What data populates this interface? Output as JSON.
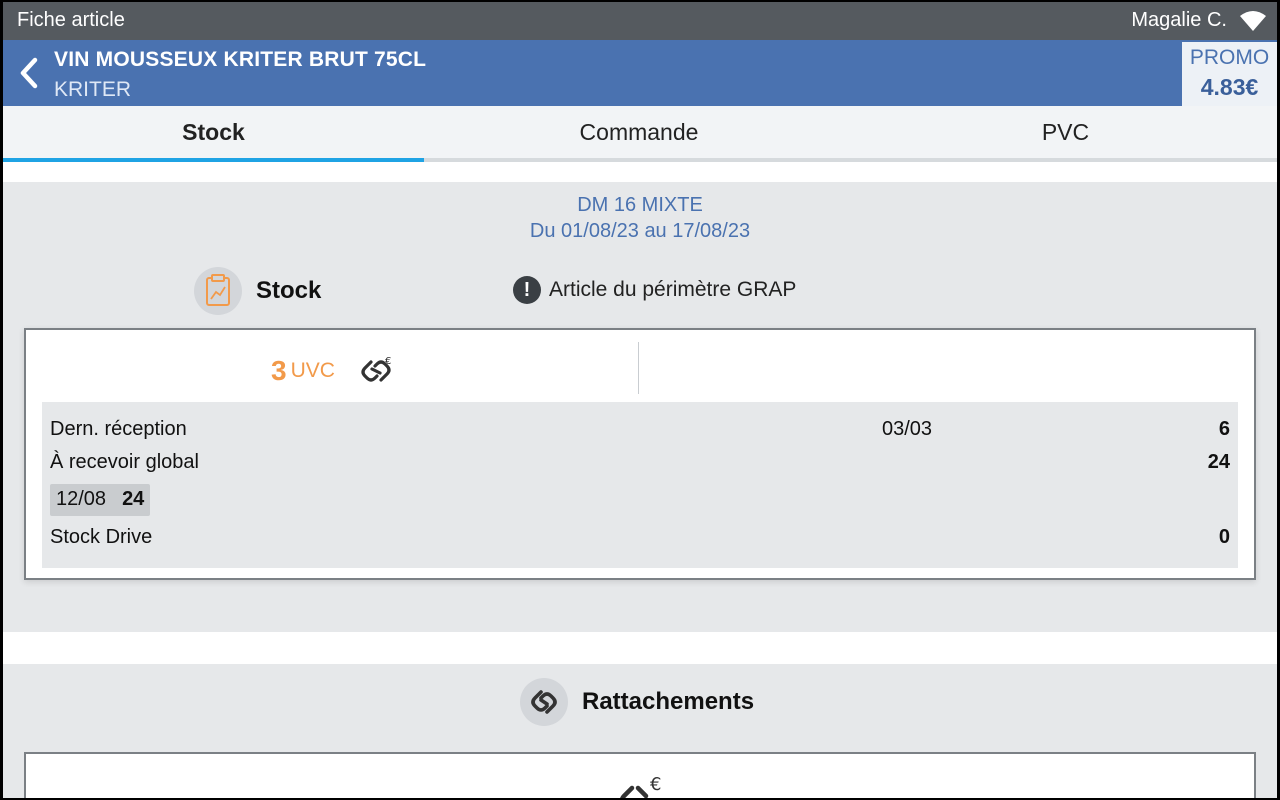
{
  "statusbar": {
    "title": "Fiche article",
    "user": "Magalie C.",
    "icons": [
      "wifi-icon"
    ]
  },
  "header": {
    "product_name": "VIN MOUSSEUX KRITER BRUT 75CL",
    "brand": "KRITER",
    "promo_label": "PROMO",
    "promo_price": "4.83€",
    "icons": [
      "back-chevron-icon"
    ]
  },
  "tabs": [
    {
      "label": "Stock",
      "active": true
    },
    {
      "label": "Commande",
      "active": false
    },
    {
      "label": "PVC",
      "active": false
    }
  ],
  "stock": {
    "period_name": "DM 16 MIXTE",
    "period_dates": "Du 01/08/23 au 17/08/23",
    "title": "Stock",
    "grap_note": "Article du périmètre GRAP",
    "uvc_qty": "3",
    "uvc_unit": "UVC",
    "rows": [
      {
        "label": "Dern. réception",
        "date": "03/03",
        "value": "6"
      },
      {
        "label": "À recevoir global",
        "value": "24"
      },
      {
        "label": "Stock Drive",
        "value": "0"
      }
    ],
    "chip": {
      "date": "12/08",
      "value": "24"
    },
    "icons": [
      "clipboard-chart-icon",
      "alert-icon",
      "link-euro-icon"
    ]
  },
  "rattachements": {
    "title": "Rattachements",
    "icons": [
      "link-icon",
      "link-euro-icon"
    ]
  },
  "colors": {
    "header_blue": "#4a72b0",
    "status_gray": "#555a5f",
    "accent_orange": "#f29a4a",
    "tab_indicator": "#1fa3e4"
  }
}
